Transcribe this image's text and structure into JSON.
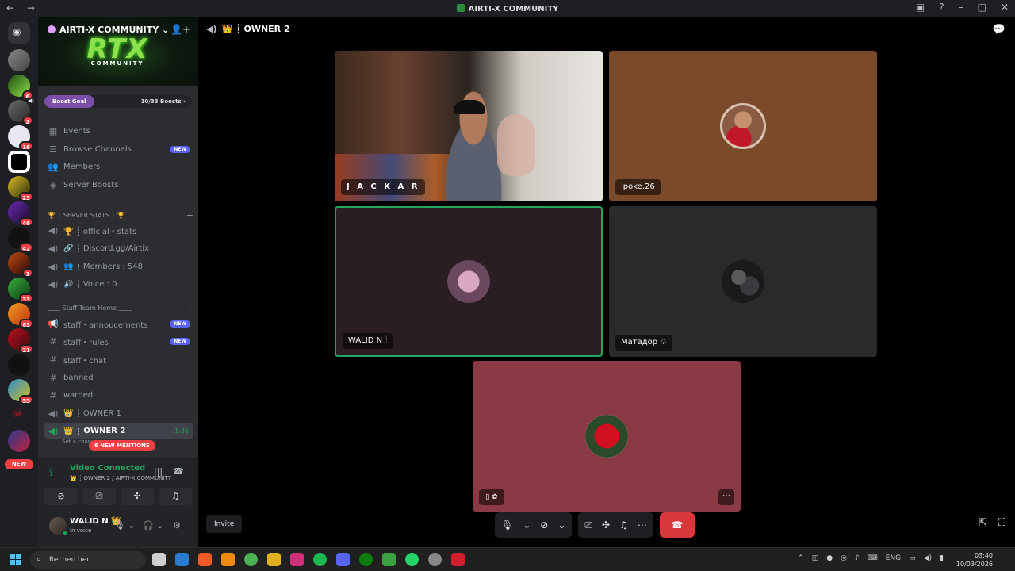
{
  "window": {
    "title": "AIRTI-X COMMUNITY"
  },
  "server": {
    "name": "AIRTI-X COMMUNITY",
    "banner_logo": "RTX",
    "banner_sub": "COMMUNITY",
    "boost_goal": "Boost Goal",
    "boost_count": "10/33 Boosts"
  },
  "guild_badges": [
    "6",
    "2",
    "16",
    "23",
    "46",
    "42",
    "1",
    "33",
    "63",
    "21",
    "53"
  ],
  "guild_new_pill": "NEW",
  "nav": {
    "events": "Events",
    "browse": "Browse Channels",
    "browse_badge": "NEW",
    "members": "Members",
    "boosts": "Server Boosts"
  },
  "categories": {
    "stats": "🏆 ┊ SERVER STATS ┊ 🏆",
    "staff": "﹏﹏ Staff Team Home ﹏﹏"
  },
  "channels": {
    "official_stats": "🏆 ┊ official・stats",
    "discord_link": "🔗 ┊ Discord.gg/Airtix",
    "members_count": "👥 ┊ Members : 548",
    "voice_count": "🔊 ┊ Voice : 0",
    "staff_announcements": "staff・annoucements",
    "staff_rules": "staff・rules",
    "staff_chat": "staff・chat",
    "banned": "banned",
    "warned": "warned",
    "owner1": "👑 ┊ OWNER 1",
    "owner2": "👑 ┊ OWNER 2",
    "owner2_time": "1:36",
    "owner2_status": "Set a chan",
    "new_badge": "NEW",
    "mentions": "6 NEW MENTIONS"
  },
  "voice": {
    "status": "Video Connected",
    "location": "👑 ┊ OWNER 2 / AIRTI-X COMMUNITY"
  },
  "user": {
    "name": "WALID N 👑",
    "status": "In voice"
  },
  "stage": {
    "channel": "👑 ┊ OWNER 2",
    "tiles": [
      {
        "name": "J A C K A R"
      },
      {
        "name": "lpoke.26"
      },
      {
        "name": "WALID N 🕯"
      },
      {
        "name": "Матадор ♤"
      }
    ],
    "invite": "Invite"
  },
  "taskbar": {
    "search_placeholder": "Rechercher",
    "lang": "ENG",
    "time": "03:40",
    "date": "10/03/2026"
  },
  "colors": {
    "accent_green": "#23a55a",
    "blurple": "#5865f2",
    "danger": "#da373c"
  }
}
